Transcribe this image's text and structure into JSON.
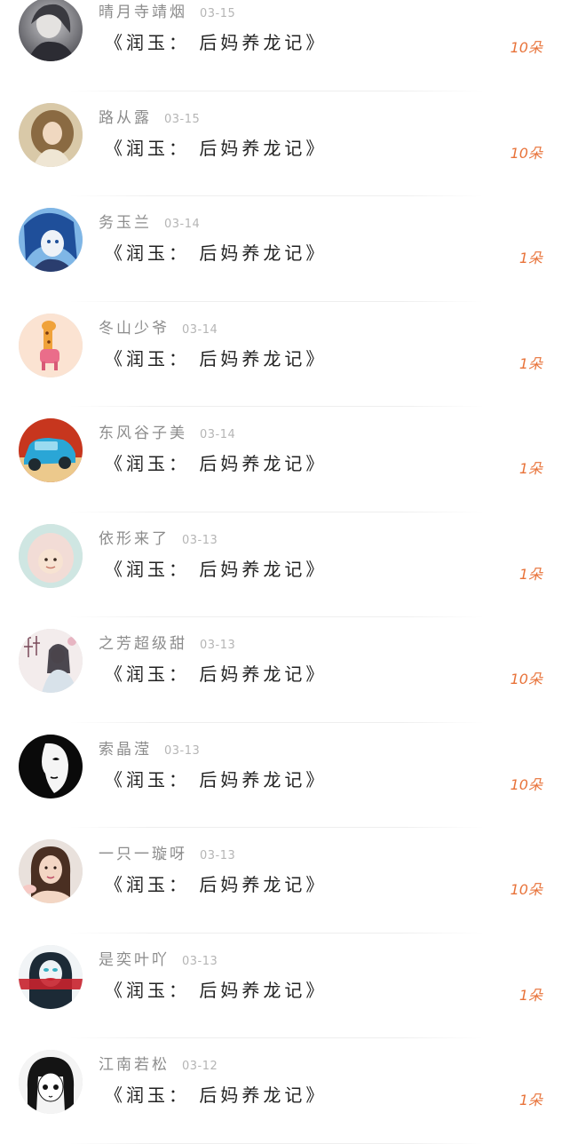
{
  "items": [
    {
      "name": "晴月寺靖烟",
      "date": "03-15",
      "title": "《润玉： 后妈养龙记》",
      "count": "10朵",
      "avatar": "avatar-gray-portrait"
    },
    {
      "name": "路从露",
      "date": "03-15",
      "title": "《润玉： 后妈养龙记》",
      "count": "10朵",
      "avatar": "avatar-curly-hair-portrait"
    },
    {
      "name": "务玉兰",
      "date": "03-14",
      "title": "《润玉： 后妈养龙记》",
      "count": "1朵",
      "avatar": "avatar-anime-blue"
    },
    {
      "name": "冬山少爷",
      "date": "03-14",
      "title": "《润玉： 后妈养龙记》",
      "count": "1朵",
      "avatar": "avatar-giraffe"
    },
    {
      "name": "东风谷子美",
      "date": "03-14",
      "title": "《润玉： 后妈养龙记》",
      "count": "1朵",
      "avatar": "avatar-blue-car"
    },
    {
      "name": "依形来了",
      "date": "03-13",
      "title": "《润玉： 后妈养龙记》",
      "count": "1朵",
      "avatar": "avatar-baby-hood"
    },
    {
      "name": "之芳超级甜",
      "date": "03-13",
      "title": "《润玉： 后妈养龙记》",
      "count": "10朵",
      "avatar": "avatar-calligraphy-figure"
    },
    {
      "name": "索晶滢",
      "date": "03-13",
      "title": "《润玉： 后妈养龙记》",
      "count": "10朵",
      "avatar": "avatar-white-mask"
    },
    {
      "name": "一只一璇呀",
      "date": "03-13",
      "title": "《润玉： 后妈养龙记》",
      "count": "10朵",
      "avatar": "avatar-girl-photo"
    },
    {
      "name": "是奕叶吖",
      "date": "03-13",
      "title": "《润玉： 后妈养龙记》",
      "count": "1朵",
      "avatar": "avatar-red-lips"
    },
    {
      "name": "江南若松",
      "date": "03-12",
      "title": "《润玉： 后妈养龙记》",
      "count": "1朵",
      "avatar": "avatar-manga-girl"
    }
  ],
  "colors": {
    "name": "#8c8c8c",
    "date": "#b5b5b5",
    "title": "#222222",
    "count": "#e8733a"
  }
}
